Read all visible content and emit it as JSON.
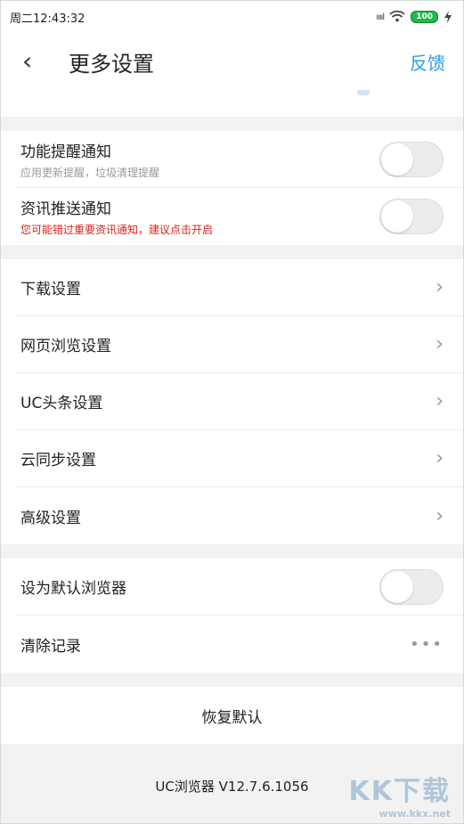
{
  "status_bar": {
    "time": "周二12:43:32",
    "battery": "100",
    "signal": "ııııl",
    "wifi": "wifi-icon",
    "charging": "charging-icon"
  },
  "header": {
    "title": "更多设置",
    "feedback": "反馈"
  },
  "notifications": [
    {
      "label": "功能提醒通知",
      "sub": "应用更新提醒，垃圾清理提醒",
      "enabled": false
    },
    {
      "label": "资讯推送通知",
      "sub": "您可能错过重要资讯通知，建议点击开启",
      "enabled": false
    }
  ],
  "settings": [
    {
      "label": "下载设置"
    },
    {
      "label": "网页浏览设置"
    },
    {
      "label": "UC头条设置"
    },
    {
      "label": "云同步设置"
    },
    {
      "label": "高级设置"
    }
  ],
  "misc": {
    "default_browser": {
      "label": "设为默认浏览器",
      "enabled": false
    },
    "clear": {
      "label": "清除记录",
      "more": "•••"
    }
  },
  "restore": "恢复默认",
  "footer": {
    "version": "UC浏览器 V12.7.6.1056"
  },
  "watermark": {
    "big": "KK下载",
    "small": "www.kkx.net"
  },
  "colors": {
    "accent": "#2a9ee6",
    "warn": "#d4261c",
    "battery": "#1fb84f"
  }
}
